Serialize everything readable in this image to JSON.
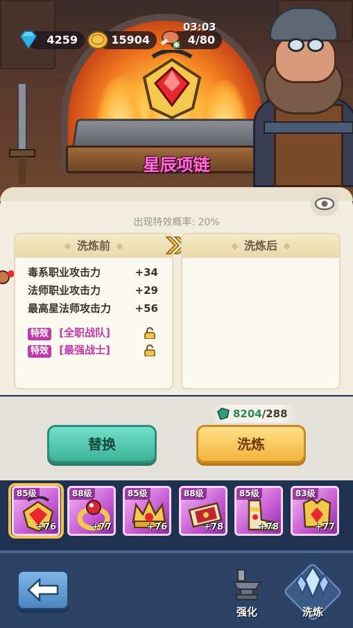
{
  "resources": {
    "diamonds": "4259",
    "gold": "15904",
    "stamina": "4/80",
    "stamina_timer": "03:03"
  },
  "item": {
    "name": "星辰项链"
  },
  "panel": {
    "chance_text": "出现特效概率: 20%",
    "before_header": "洗炼前",
    "after_header": "洗炼后",
    "stats": [
      {
        "name": "毒系职业攻击力",
        "value": "+34"
      },
      {
        "name": "法师职业攻击力",
        "value": "+29"
      },
      {
        "name": "最高星法师攻击力",
        "value": "+56"
      }
    ],
    "specials": [
      {
        "tag": "特效",
        "name": "[全职战队]"
      },
      {
        "tag": "特效",
        "name": "[最强战士]"
      }
    ]
  },
  "cost": {
    "have": "8204",
    "need": "/288"
  },
  "buttons": {
    "replace": "替换",
    "reforge": "洗炼"
  },
  "equipment": [
    {
      "level": "85级",
      "bonus": "+76",
      "icon": "necklace-icon"
    },
    {
      "level": "88级",
      "bonus": "+77",
      "icon": "ring-icon"
    },
    {
      "level": "85级",
      "bonus": "+76",
      "icon": "crown-icon"
    },
    {
      "level": "88级",
      "bonus": "+78",
      "icon": "horn-bracer-icon"
    },
    {
      "level": "85级",
      "bonus": "+78",
      "icon": "boots-icon"
    },
    {
      "level": "83级",
      "bonus": "+77",
      "icon": "armor-icon"
    }
  ],
  "nav": {
    "enhance": "强化",
    "reforge": "洗炼"
  },
  "colors": {
    "accent_pink": "#c23aa8",
    "replace_green": "#3fb39a",
    "reforge_gold": "#f3b43c",
    "title_pink": "#ff6fd6"
  }
}
